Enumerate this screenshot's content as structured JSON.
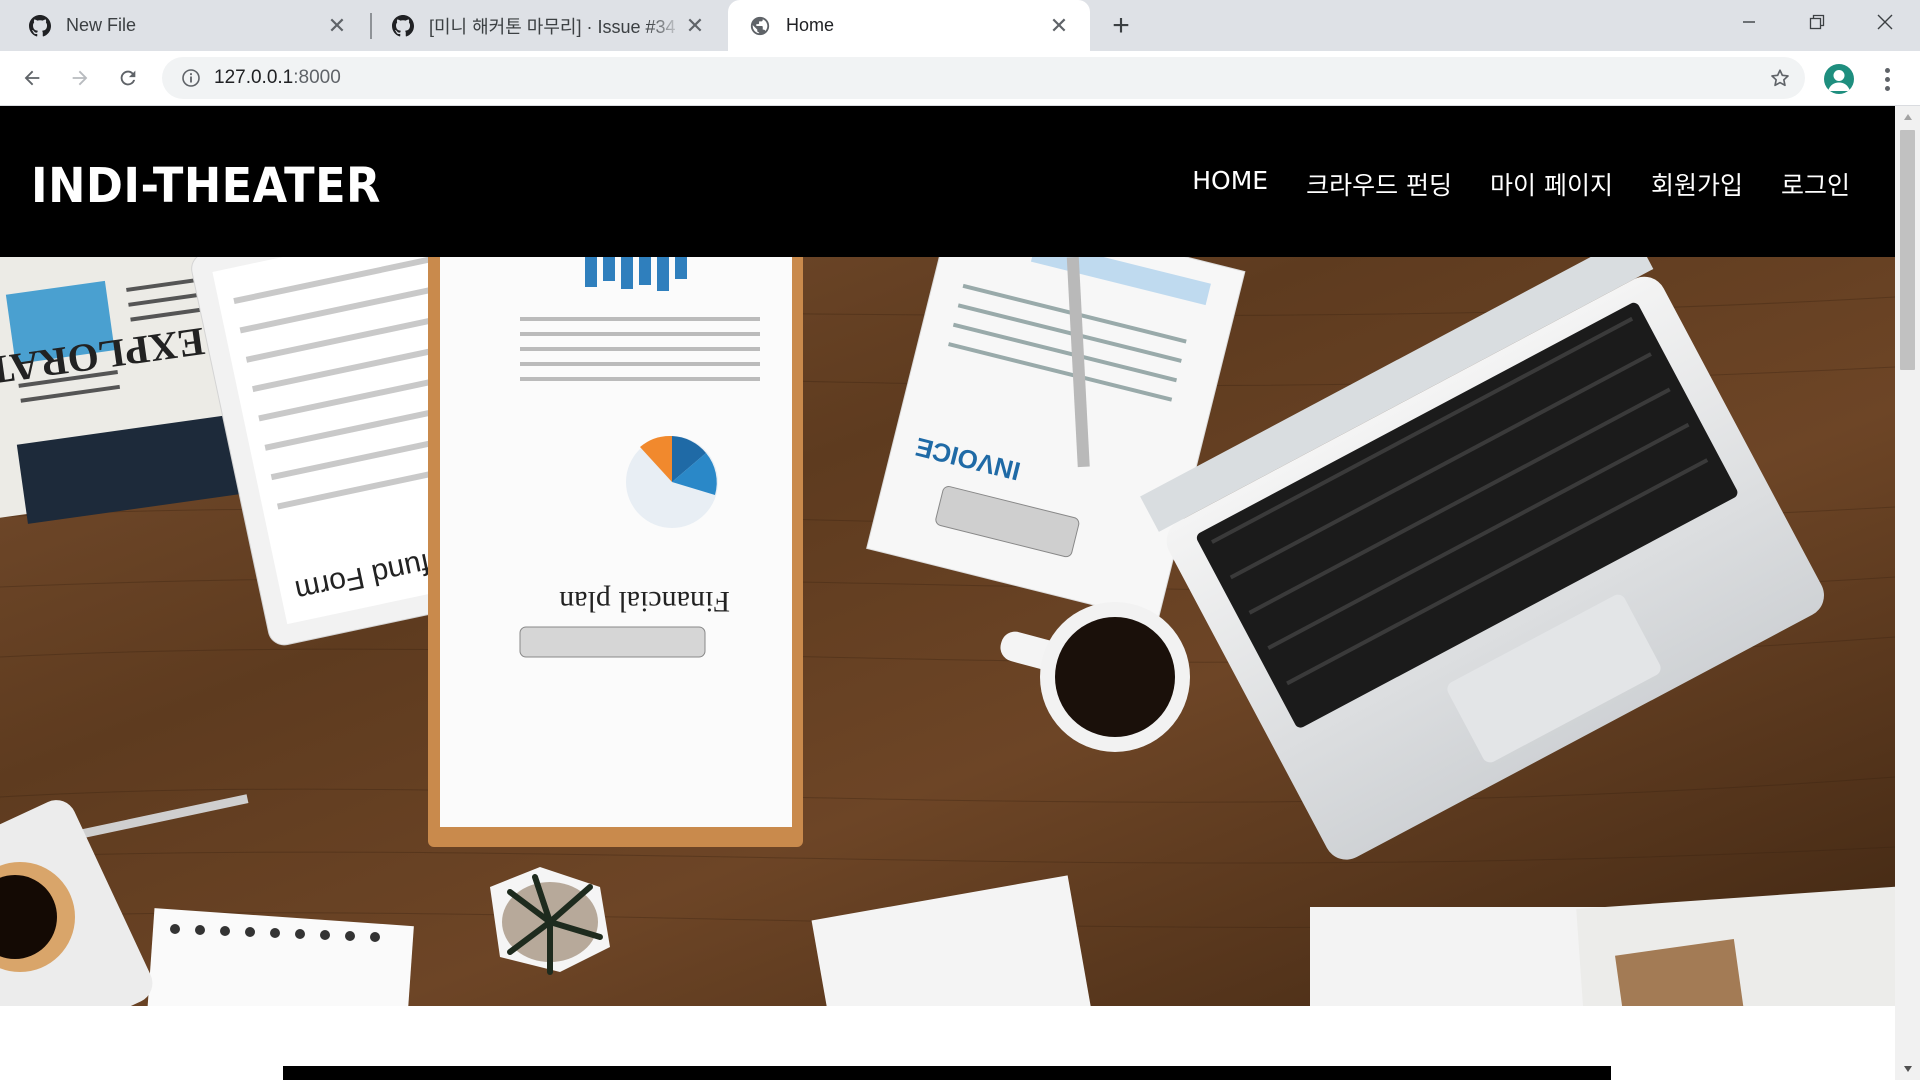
{
  "browser": {
    "tabs": [
      {
        "title": "New File",
        "icon": "github-icon",
        "active": false
      },
      {
        "title": "[미니 해커톤 마무리] · Issue #34",
        "icon": "github-icon",
        "active": false
      },
      {
        "title": "Home",
        "icon": "globe-icon",
        "active": true
      }
    ],
    "new_tab_label": "+",
    "close_glyph": "✕",
    "address": {
      "host": "127.0.0.1",
      "port": ":8000"
    }
  },
  "site": {
    "brand": "INDI-THEATER",
    "nav": [
      {
        "label": "HOME"
      },
      {
        "label": "크라우드 펀딩"
      },
      {
        "label": "마이 페이지"
      },
      {
        "label": "회원가입"
      },
      {
        "label": "로그인"
      }
    ]
  },
  "hero": {
    "image_texts": [
      "Tax Refund Form",
      "Financial plan",
      "INVOICE",
      "EXPLORATION"
    ]
  },
  "colors": {
    "header_bg": "#000000",
    "tabstrip_bg": "#dee1e6",
    "omnibox_bg": "#f1f3f4",
    "avatar": "#1e8e7e"
  }
}
